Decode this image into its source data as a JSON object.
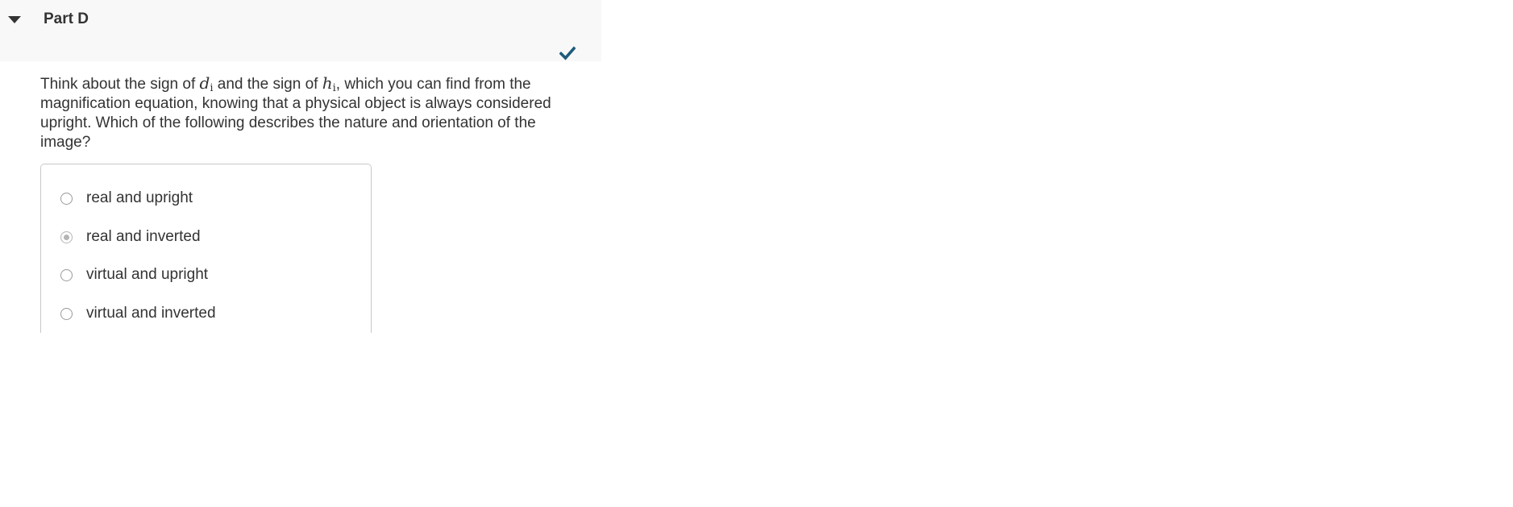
{
  "part": {
    "title": "Part D",
    "expanded": true,
    "status": "correct",
    "accent_color": "#1f5a7a"
  },
  "question": {
    "text_1": "Think about the sign of ",
    "var_1": "d",
    "var_1_sub": "i",
    "text_2": " and the sign of ",
    "var_2": "h",
    "var_2_sub": "i",
    "text_3": ", which you can find from the magnification equation, knowing that a physical object is always considered upright. Which of the following describes the nature and orientation of the image?"
  },
  "options": [
    {
      "label": "real and upright",
      "selected": false
    },
    {
      "label": "real and inverted",
      "selected": true
    },
    {
      "label": "virtual and upright",
      "selected": false
    },
    {
      "label": "virtual and inverted",
      "selected": false
    }
  ]
}
